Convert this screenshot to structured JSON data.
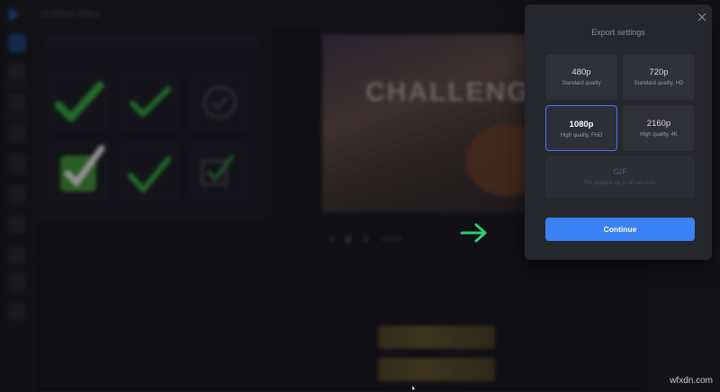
{
  "editor": {
    "project_title": "Untitled video",
    "video_overlay_text": "CHALLENGE",
    "accent_color": "#3b82f6",
    "arrow_color": "#2ecc71"
  },
  "modal": {
    "title": "Export settings",
    "options": [
      {
        "title": "480p",
        "subtitle": "Standard quality",
        "selected": false
      },
      {
        "title": "720p",
        "subtitle": "Standard quality, HD",
        "selected": false
      },
      {
        "title": "1080p",
        "subtitle": "High quality, FHD",
        "selected": true
      },
      {
        "title": "2160p",
        "subtitle": "High quality, 4K",
        "selected": false
      }
    ],
    "gif": {
      "title": "GIF",
      "subtitle": "For projects up to 30 seconds",
      "disabled": true
    },
    "continue_label": "Continue"
  },
  "watermark": "wfxdn.com"
}
